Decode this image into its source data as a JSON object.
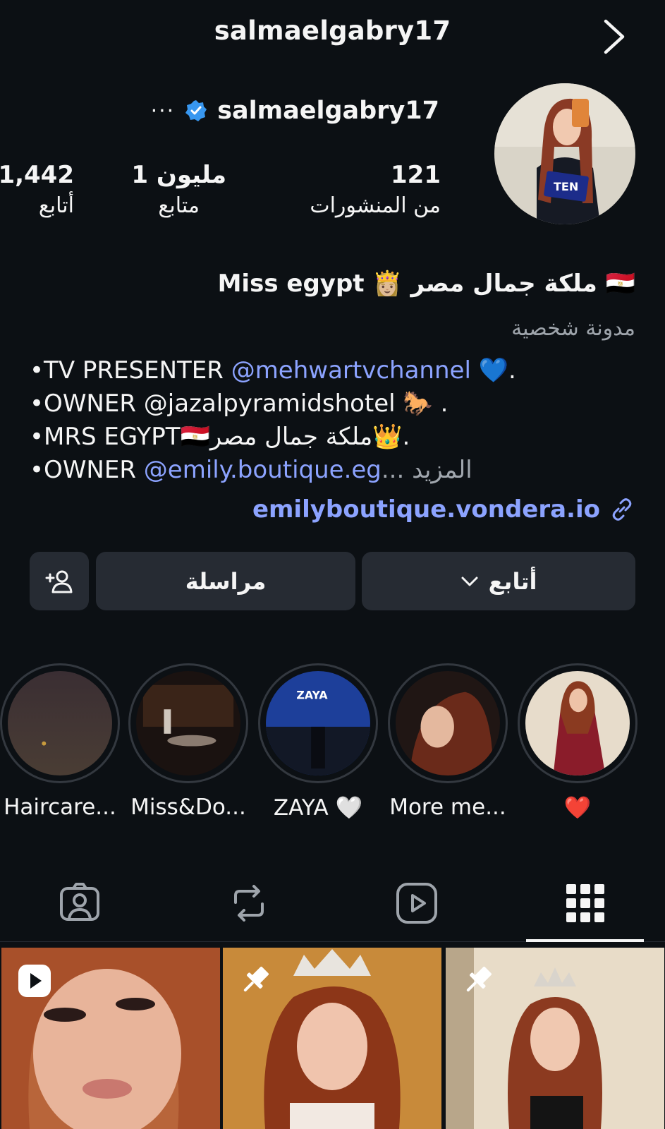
{
  "header": {
    "title": "salmaelgabry17",
    "back_icon": "chevron-right-icon"
  },
  "profile": {
    "username": "salmaelgabry17",
    "more_label": "···",
    "verified_color": "#3897f0",
    "stats": {
      "posts": {
        "value": "121",
        "label": "من المنشورات"
      },
      "followers": {
        "value": "1 مليون",
        "label": "متابع"
      },
      "following": {
        "value": "1,442",
        "label": "أتابع"
      }
    },
    "display_name": "🇪🇬 ملكة جمال مصر 👸🏼 Miss egypt",
    "category": "مدونة شخصية",
    "bio": {
      "line1_text": "•TV PRESENTER ",
      "line1_mention": "@mehwartvchannel",
      "line1_end": " 💙.",
      "line2": "•OWNER @jazalpyramidshotel 🐎 .",
      "line3": "•MRS EGYPT🇪🇬ملكة جمال مصر👑.",
      "line4_text": "•OWNER ",
      "line4_mention": "@emily.boutique.eg",
      "line4_more": "... المزيد"
    },
    "link": "emilyboutique.vondera.io"
  },
  "actions": {
    "follow_label": "أتابع",
    "message_label": "مراسلة",
    "add_user_icon": "add-user-icon"
  },
  "highlights": [
    {
      "label": "Haircare..."
    },
    {
      "label": "Miss&Do..."
    },
    {
      "label": "ZAYA 🤍"
    },
    {
      "label": "More me..."
    },
    {
      "label": "❤️"
    }
  ],
  "tabs": [
    "user-tag-icon",
    "reposts-icon",
    "reels-icon",
    "grid-icon"
  ],
  "accent": {
    "link_color": "#8ca3ff",
    "background": "#0c1014",
    "button_bg": "#262b33"
  }
}
